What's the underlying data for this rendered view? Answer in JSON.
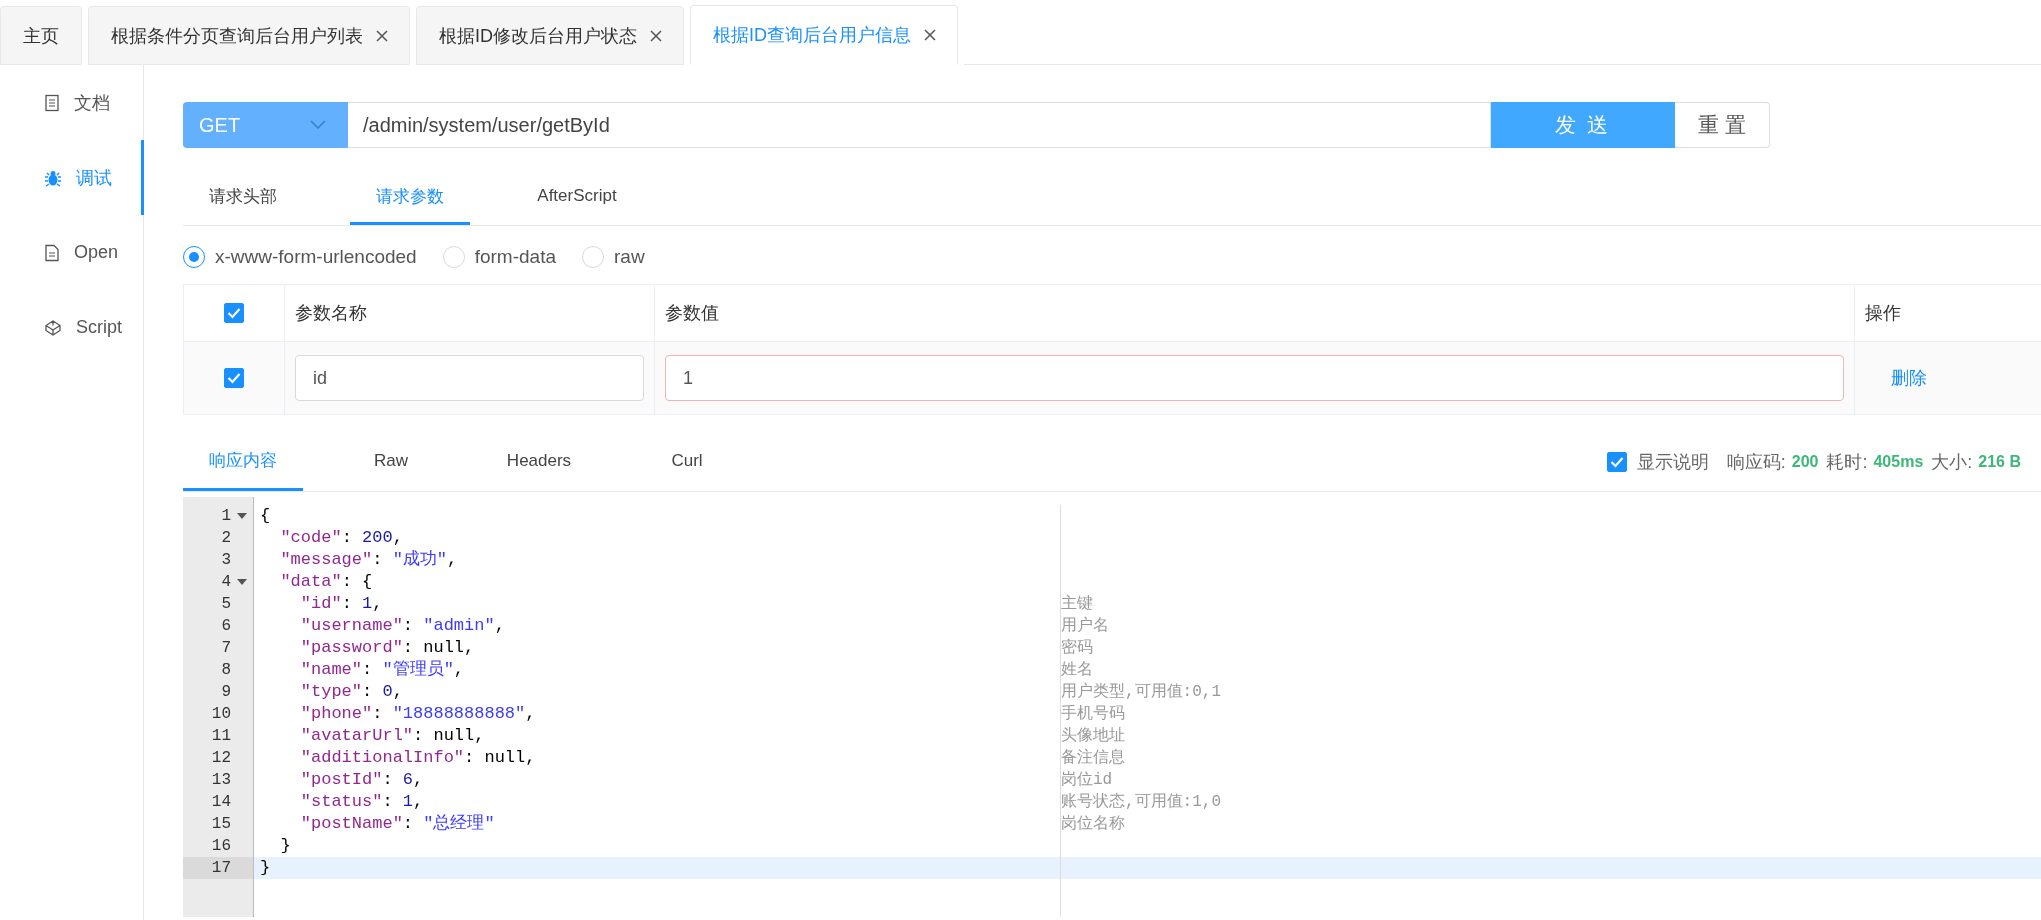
{
  "tabs": [
    {
      "label": "主页",
      "selected": false,
      "closable": false
    },
    {
      "label": "根据条件分页查询后台用户列表",
      "selected": false,
      "closable": true
    },
    {
      "label": "根据ID修改后台用户状态",
      "selected": false,
      "closable": true
    },
    {
      "label": "根据ID查询后台用户信息",
      "selected": true,
      "closable": true
    }
  ],
  "sidebar": {
    "items": [
      {
        "label": "文档",
        "kind": "doc",
        "selected": false
      },
      {
        "label": "调试",
        "kind": "bug",
        "selected": true
      },
      {
        "label": "Open",
        "kind": "file",
        "selected": false
      },
      {
        "label": "Script",
        "kind": "cube",
        "selected": false
      }
    ]
  },
  "request": {
    "method": "GET",
    "url": "/admin/system/user/getById",
    "buttons": [
      {
        "label": "发 送",
        "kind": "primary"
      },
      {
        "label": "重 置",
        "kind": "default"
      }
    ]
  },
  "request_tabs": [
    {
      "label": "请求头部",
      "selected": false
    },
    {
      "label": "请求参数",
      "selected": true
    },
    {
      "label": "AfterScript",
      "selected": false
    }
  ],
  "body_types": [
    {
      "label": "x-www-form-urlencoded",
      "selected": true
    },
    {
      "label": "form-data",
      "selected": false
    },
    {
      "label": "raw",
      "selected": false
    }
  ],
  "params": {
    "all_checked": true,
    "columns": [
      "参数名称",
      "参数值",
      "操作"
    ],
    "rows": [
      {
        "checked": true,
        "name": "id",
        "value": "1",
        "error": true,
        "action": "删除"
      }
    ]
  },
  "response_tabs": [
    {
      "label": "响应内容",
      "selected": true
    },
    {
      "label": "Raw",
      "selected": false
    },
    {
      "label": "Headers",
      "selected": false
    },
    {
      "label": "Curl",
      "selected": false
    }
  ],
  "show_description": {
    "label": "显示说明",
    "checked": true
  },
  "stats": [
    {
      "label": "响应码:",
      "value": "200"
    },
    {
      "label": "耗时:",
      "value": "405ms"
    },
    {
      "label": "大小:",
      "value": "216 B"
    }
  ],
  "code": [
    {
      "number": "1",
      "text": "{",
      "fold": true,
      "active": false
    },
    {
      "number": "2",
      "text": "  \"code\": 200,",
      "fold": false,
      "active": false
    },
    {
      "number": "3",
      "text": "  \"message\": \"成功\",",
      "fold": false,
      "active": false
    },
    {
      "number": "4",
      "text": "  \"data\": {",
      "fold": true,
      "active": false
    },
    {
      "number": "5",
      "text": "    \"id\": 1,",
      "comment": "主键",
      "fold": false,
      "active": false
    },
    {
      "number": "6",
      "text": "    \"username\": \"admin\",",
      "comment": "用户名",
      "fold": false,
      "active": false
    },
    {
      "number": "7",
      "text": "    \"password\": null,",
      "comment": "密码",
      "fold": false,
      "active": false
    },
    {
      "number": "8",
      "text": "    \"name\": \"管理员\",",
      "comment": "姓名",
      "fold": false,
      "active": false
    },
    {
      "number": "9",
      "text": "    \"type\": 0,",
      "comment": "用户类型,可用值:0,1",
      "fold": false,
      "active": false
    },
    {
      "number": "10",
      "text": "    \"phone\": \"18888888888\",",
      "comment": "手机号码",
      "fold": false,
      "active": false
    },
    {
      "number": "11",
      "text": "    \"avatarUrl\": null,",
      "comment": "头像地址",
      "fold": false,
      "active": false
    },
    {
      "number": "12",
      "text": "    \"additionalInfo\": null,",
      "comment": "备注信息",
      "fold": false,
      "active": false
    },
    {
      "number": "13",
      "text": "    \"postId\": 6,",
      "comment": "岗位id",
      "fold": false,
      "active": false
    },
    {
      "number": "14",
      "text": "    \"status\": 1,",
      "comment": "账号状态,可用值:1,0",
      "fold": false,
      "active": false
    },
    {
      "number": "15",
      "text": "    \"postName\": \"总经理\"",
      "comment": "岗位名称",
      "fold": false,
      "active": false
    },
    {
      "number": "16",
      "text": "  }",
      "fold": false,
      "active": false
    },
    {
      "number": "17",
      "text": "}",
      "fold": false,
      "active": true
    }
  ]
}
